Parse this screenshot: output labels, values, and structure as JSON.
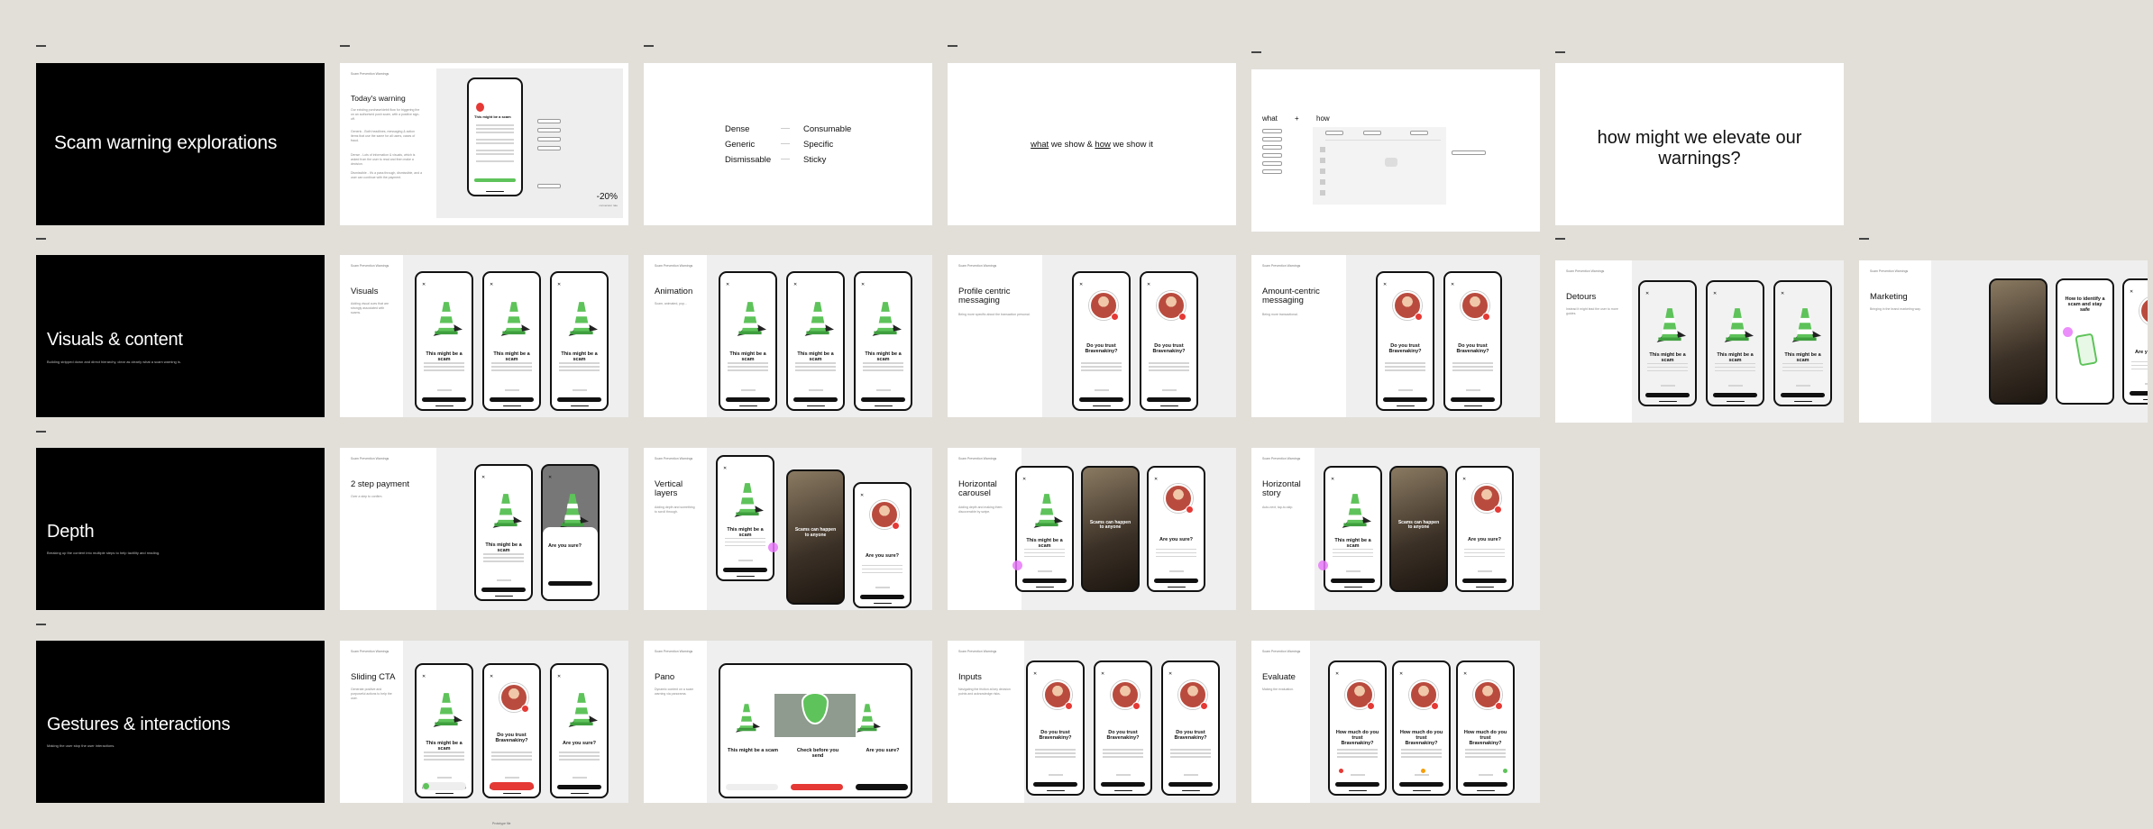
{
  "sections": [
    {
      "title": "Scam warning explorations",
      "subtitle": ""
    },
    {
      "title": "Visuals & content",
      "subtitle": "Building stripped down and direct hierarchy, clear as clearly what a scam warning is."
    },
    {
      "title": "Depth",
      "subtitle": "Breaking up the content into multiple steps to help tactility and reading."
    },
    {
      "title": "Gestures & interactions",
      "subtitle": "Making the user stop the user interactions."
    }
  ],
  "row1": {
    "todays": {
      "label": "Scam Prevention Warnings",
      "title": "Today's warning",
      "desc": "Our existing purchase/debit flow for triggering the on an authorised push scam, with a positive sign-off.",
      "notes": [
        "Generic - Both headlines, messaging & action items that use the same for all users, cases of fraud.",
        "Dense - Lots of information & visuals, which is asked from the user to read and then make a decision.",
        "Dismissible - It's a pass through, dismissible, and a user can continue with the payment."
      ],
      "phone_title": "This might be a scam",
      "stat": "-20%",
      "stat_caption": "conversion rate"
    },
    "compare": {
      "header": "",
      "left": [
        "Dense",
        "Generic",
        "Dismissable"
      ],
      "right": [
        "Consumable",
        "Specific",
        "Sticky"
      ]
    },
    "whatshow": {
      "caption": "",
      "w1": "what",
      "mid": " we show & ",
      "w2": "how",
      "end": " we show it"
    },
    "whathow": {
      "label": "",
      "what": "what",
      "plus": "+",
      "how": "how"
    },
    "question": "how might we elevate our warnings?"
  },
  "row2": [
    {
      "label": "Scam Prevention Warnings",
      "title": "Visuals",
      "desc": "Adding visual cues that are strongly associated with scams."
    },
    {
      "label": "Scam Prevention Warnings",
      "title": "Animation",
      "desc": "Scam, animated, pop..."
    },
    {
      "label": "Scam Prevention Warnings",
      "title": "Profile centric messaging",
      "desc": "Being more specific about the transaction personal."
    },
    {
      "label": "Scam Prevention Warnings",
      "title": "Amount-centric messaging",
      "desc": "Being more transactional."
    },
    {
      "label": "Scam Prevention Warnings",
      "title": "Detours",
      "desc": "Instead it might lead the user to more guides."
    },
    {
      "label": "Scam Prevention Warnings",
      "title": "Marketing",
      "desc": "Bringing in the brand marketing way."
    }
  ],
  "row3": [
    {
      "label": "Scam Prevention Warnings",
      "title": "2 step payment",
      "desc": "Over a step to confirm."
    },
    {
      "label": "Scam Prevention Warnings",
      "title": "Vertical layers",
      "desc": "Adding depth and something to scroll through."
    },
    {
      "label": "Scam Prevention Warnings",
      "title": "Horizontal carousel",
      "desc": "Adding depth and making them discoverable by swipe."
    },
    {
      "label": "Scam Prevention Warnings",
      "title": "Horizontal story",
      "desc": "Auto-next, tap-to-skip."
    }
  ],
  "row4": [
    {
      "label": "Scam Prevention Warnings",
      "title": "Sliding CTA",
      "desc": "Generate positive and purposeful actions to help the user."
    },
    {
      "label": "Scam Prevention Warnings",
      "title": "Pano",
      "desc": "Dynamic content on a scam warning via panorama."
    },
    {
      "label": "Scam Prevention Warnings",
      "title": "Inputs",
      "desc": "Navigating the friction at key decision points and acknowledge risks."
    },
    {
      "label": "Scam Prevention Warnings",
      "title": "Evaluate",
      "desc": "Making the evaluation."
    }
  ],
  "phones": {
    "scam": "This might be a scam",
    "trust": "Do you trust Bravenakiny?",
    "sure": "Are you sure?",
    "happen": "Scams can happen to anyone",
    "check": "Check before you send",
    "identify": "How to identify a scam and stay safe",
    "howmuch": "How much do you trust Bravenakiny?",
    "detour_top": "Are you suspicious?"
  },
  "footer": "Prototype file",
  "colors": {
    "background": "#e2dfd9",
    "black": "#000000",
    "green": "#5ec35a",
    "red": "#e53935",
    "pink": "#e879f9"
  }
}
